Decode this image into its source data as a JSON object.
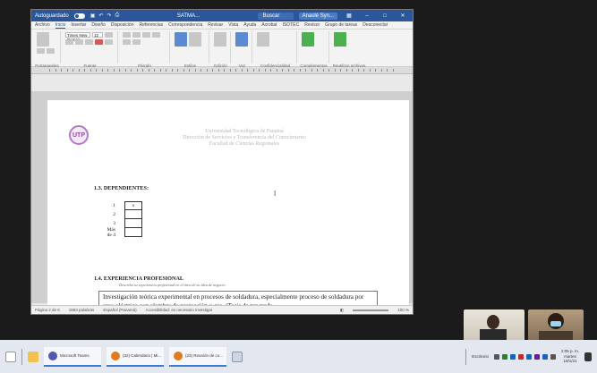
{
  "window": {
    "autosave_label": "Autoguardado",
    "doc_title": "SATMA...",
    "search_placeholder": "Buscar",
    "user_label": "Anaslé Syn..."
  },
  "menu": [
    "Archivo",
    "Inicio",
    "Insertar",
    "Diseño",
    "Disposición",
    "Referencias",
    "Correspondencia",
    "Revisar",
    "Vista",
    "Ayuda",
    "Acrobat",
    "ISOTEC",
    "Revisor",
    "Grupo de tareas",
    "Desconectar"
  ],
  "ribbon": {
    "font_name": "Times New Roman",
    "font_size": "12",
    "groups": [
      "Portapapeles",
      "Fuente",
      "Párrafo",
      "Estilos",
      "Edición",
      "Voz",
      "Confidencialidad",
      "Complementos",
      "Reutilizar archivos"
    ]
  },
  "document": {
    "institution_lines": [
      "Universidad Tecnológica de Panamá",
      "Dirección de Servicios y Transferencia del Conocimiento",
      "Facultad de Ciencias Regionales"
    ],
    "section_13": "1.3. DEPENDIENTES:",
    "dependents": [
      {
        "label": "1",
        "value": "x"
      },
      {
        "label": "2",
        "value": ""
      },
      {
        "label": "3",
        "value": ""
      },
      {
        "label": "Más de 4",
        "value": ""
      }
    ],
    "section_14": "1.4. EXPERIENCIA PROFESIONAL",
    "section_14_sub": "Describa su experiencia profesional en el área de su idea de negocio",
    "body_text": "Investigación teórica experimental en procesos de soldadura, especialmente proceso de soldadura por arco eléctrico con alambre de protección y gas. (Tesis de pregrado."
  },
  "statusbar": {
    "page": "Página 2 de 6",
    "words": "1883 palabras",
    "lang": "Español (Panamá)",
    "access": "Accesibilidad: es necesario investigar",
    "zoom": "100 %"
  },
  "taskbar": {
    "apps": [
      {
        "label": "Microsoft Teams",
        "color": "#5558af"
      },
      {
        "label": "(32) Calendario | Mi...",
        "color": "#e07a1f"
      },
      {
        "label": "(23) Reunión de co...",
        "color": "#e07a1f"
      }
    ],
    "weather": "Escritorio",
    "clock_time": "2:05 p. m.",
    "clock_day": "martes",
    "clock_date": "19/1/21"
  },
  "colors": {
    "word_blue": "#2b579a",
    "accent": "#3b78d8"
  }
}
